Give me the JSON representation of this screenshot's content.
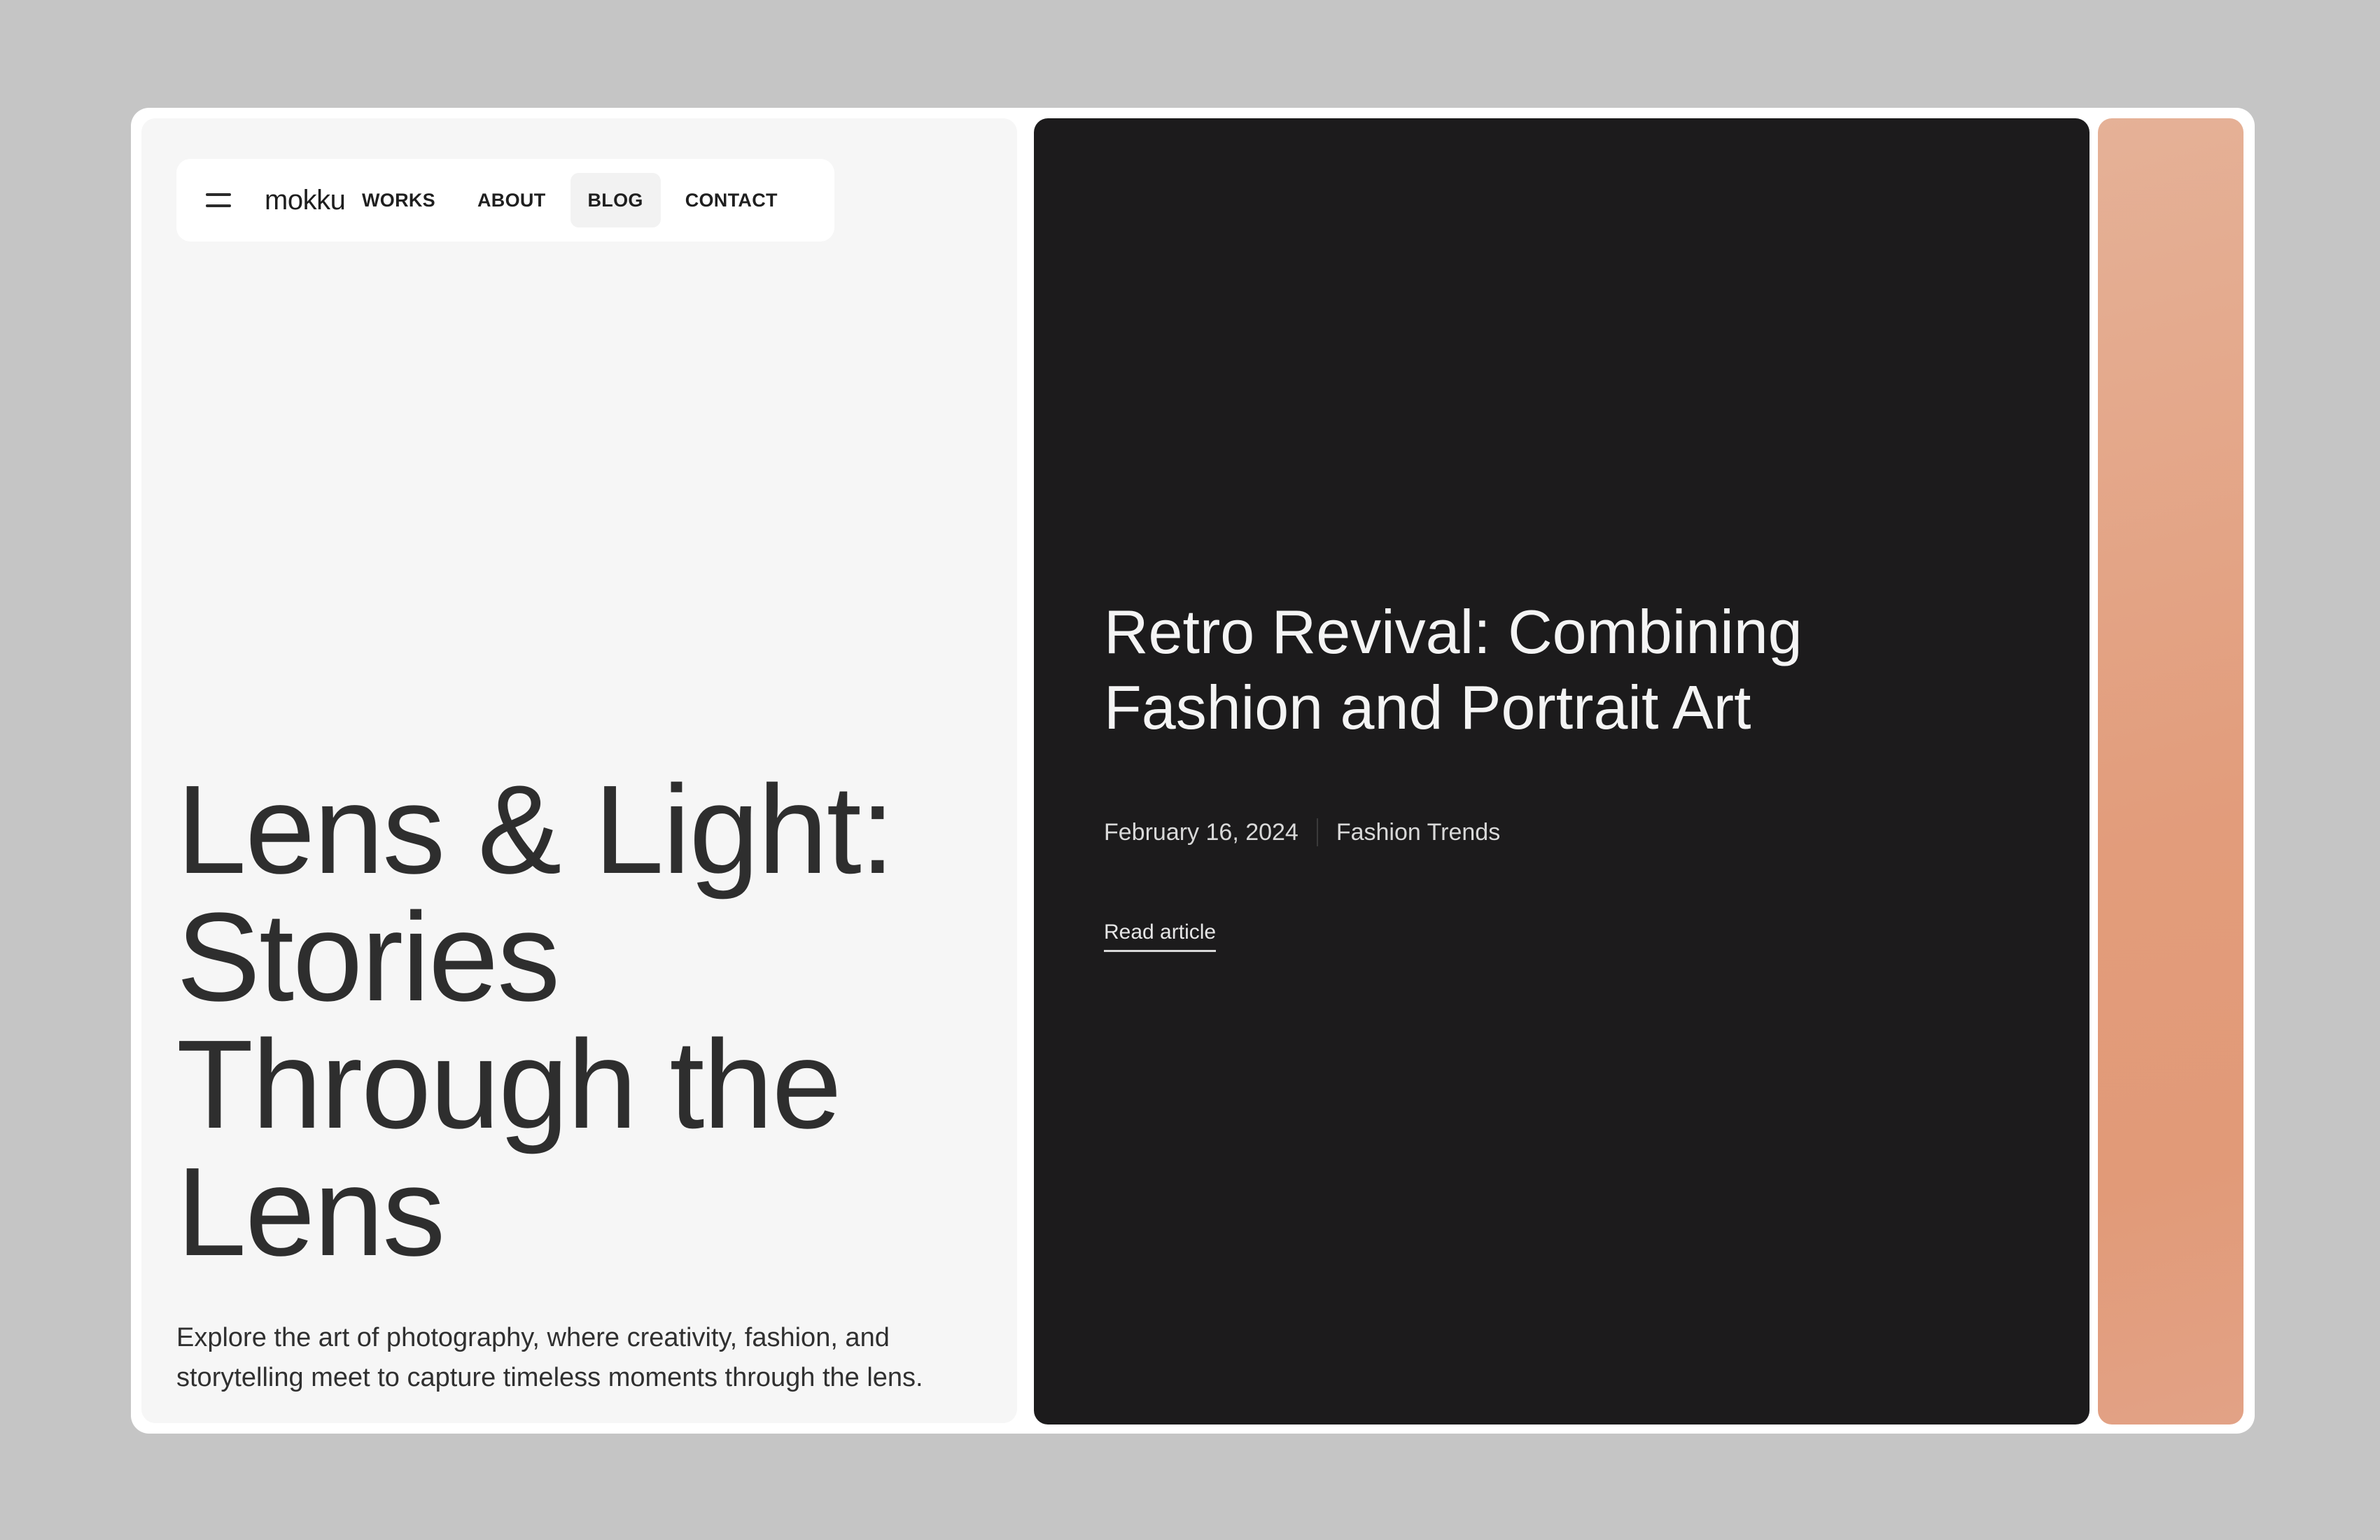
{
  "header": {
    "logo": "mokku",
    "nav": [
      {
        "label": "WORKS",
        "active": false
      },
      {
        "label": "ABOUT",
        "active": false
      },
      {
        "label": "BLOG",
        "active": true
      },
      {
        "label": "CONTACT",
        "active": false
      }
    ]
  },
  "hero": {
    "title_lines": [
      "Lens & Light:",
      "Stories",
      "Through the",
      "Lens"
    ],
    "description_lines": [
      "Explore the art of photography, where creativity, fashion, and",
      "storytelling meet to capture timeless moments through the lens."
    ]
  },
  "featured": {
    "title_lines": [
      "Retro Revival: Combining",
      "Fashion and Portrait Art"
    ],
    "date": "February 16, 2024",
    "category": "Fashion Trends",
    "link_label": "Read article"
  },
  "colors": {
    "background": "#c5c5c5",
    "panel": "#f6f6f6",
    "dark_card": "#1c1b1c",
    "peach_card": "#e29c7b"
  }
}
